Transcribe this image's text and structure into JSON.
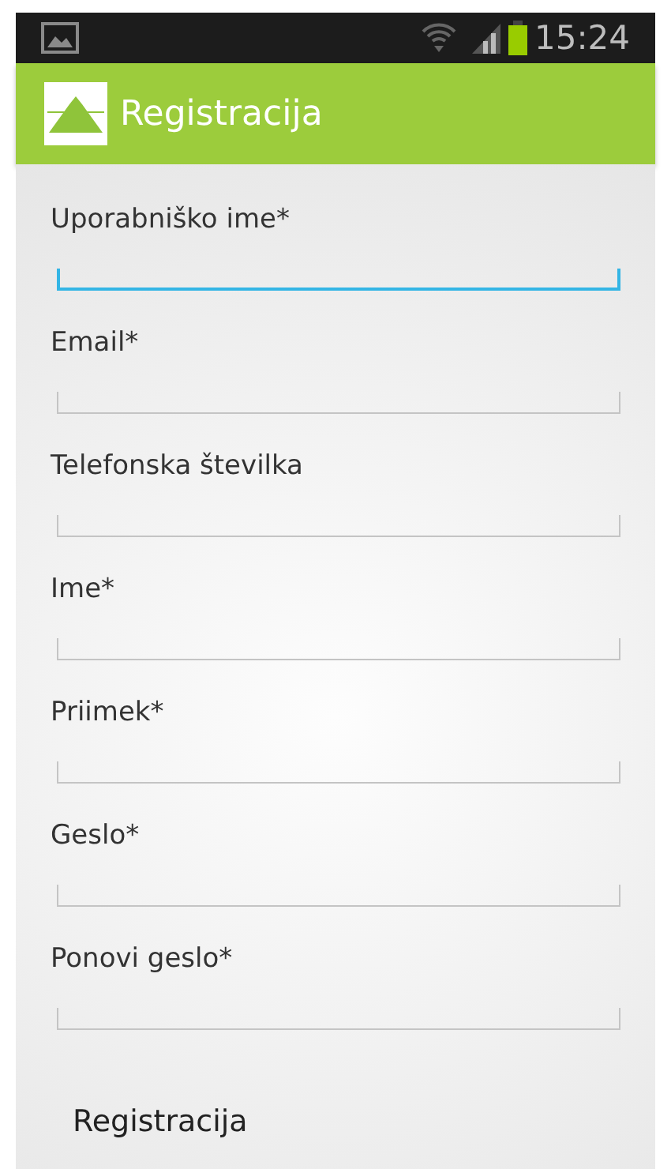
{
  "status_bar": {
    "time": "15:24"
  },
  "app_bar": {
    "title": "Registracija"
  },
  "fields": [
    {
      "label": "Uporabniško ime*",
      "focused": true
    },
    {
      "label": "Email*",
      "focused": false
    },
    {
      "label": "Telefonska številka",
      "focused": false
    },
    {
      "label": "Ime*",
      "focused": false
    },
    {
      "label": "Priimek*",
      "focused": false
    },
    {
      "label": "Geslo*",
      "focused": false
    },
    {
      "label": "Ponovi geslo*",
      "focused": false
    }
  ],
  "button": {
    "label": "Registracija"
  }
}
